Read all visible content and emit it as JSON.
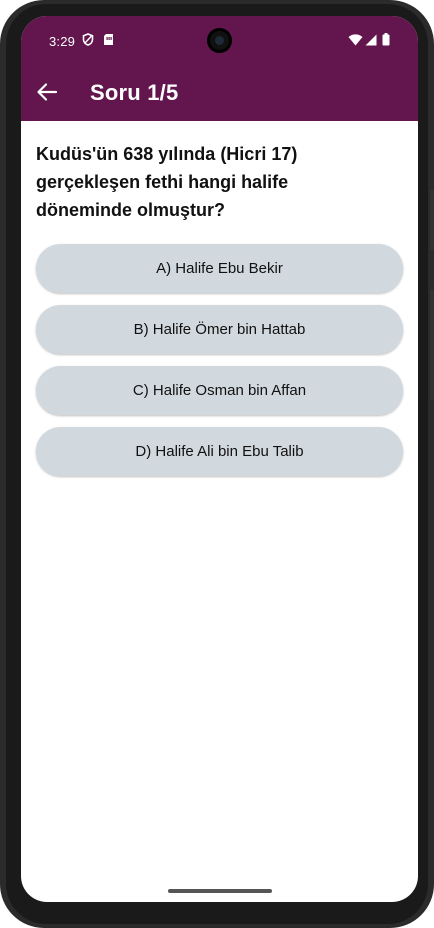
{
  "status_bar": {
    "time": "3:29",
    "left_icons": [
      "shield-icon",
      "sim-card-icon"
    ],
    "right_icons": [
      "wifi-icon",
      "signal-icon",
      "battery-icon"
    ]
  },
  "app_bar": {
    "title": "Soru 1/5",
    "back_icon": "arrow-left-icon",
    "color": "#62164d"
  },
  "question": {
    "text": "Kudüs'ün 638 yılında (Hicri 17) gerçekleşen fethi hangi halife döneminde olmuştur?"
  },
  "options": [
    {
      "label": "A) Halife Ebu Bekir"
    },
    {
      "label": "B) Halife Ömer bin Hattab"
    },
    {
      "label": "C) Halife Osman bin Affan"
    },
    {
      "label": "D) Halife Ali bin Ebu Talib"
    }
  ],
  "colors": {
    "primary": "#62164d",
    "option_bg": "#d2d9de",
    "text": "#111111"
  }
}
